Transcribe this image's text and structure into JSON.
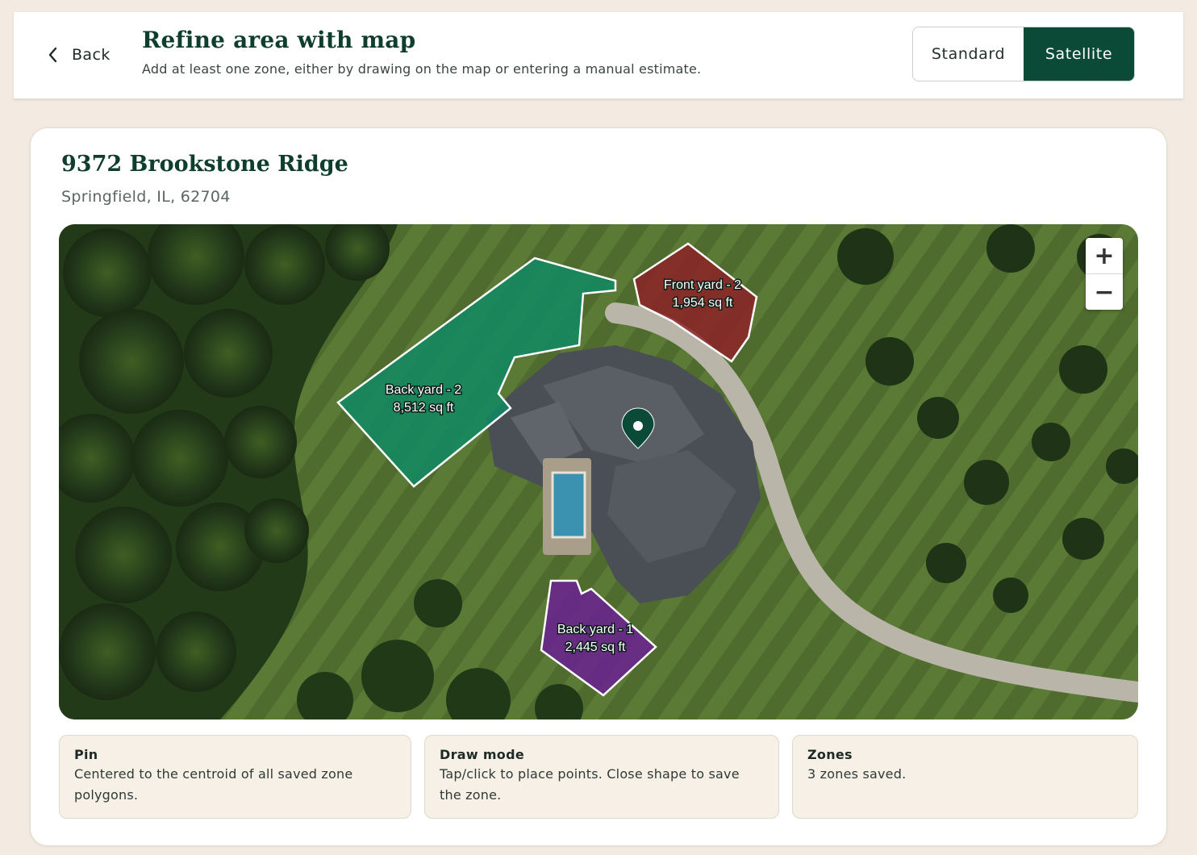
{
  "header": {
    "back_label": "Back",
    "title": "Refine area with map",
    "subtitle": "Add at least one zone, either by drawing on the map or entering a manual estimate.",
    "map_types": [
      {
        "label": "Standard",
        "selected": false
      },
      {
        "label": "Satellite",
        "selected": true
      }
    ]
  },
  "property": {
    "address": "9372 Brookstone Ridge",
    "city_line": "Springfield, IL, 62704"
  },
  "map": {
    "view": "satellite",
    "zoom_in_label": "+",
    "zoom_out_label": "−",
    "zones": [
      {
        "name": "Back yard - 2",
        "area": "8,512 sq ft",
        "color": "#0f8a64"
      },
      {
        "name": "Front yard - 2",
        "area": "1,954 sq ft",
        "color": "#8e1e25"
      },
      {
        "name": "Back yard - 1",
        "area": "2,445 sq ft",
        "color": "#6a2390"
      }
    ],
    "pin_color": "#0b4a37"
  },
  "info_panels": [
    {
      "heading": "Pin",
      "text": "Centered to the centroid of all saved zone polygons."
    },
    {
      "heading": "Draw mode",
      "text": "Tap/click to place points. Close shape to save the zone."
    },
    {
      "heading": "Zones",
      "text": "3 zones saved."
    }
  ],
  "colors": {
    "brand_dark": "#0a4a37",
    "title_green": "#0f3d2e",
    "page_background": "#f3ebe1"
  }
}
